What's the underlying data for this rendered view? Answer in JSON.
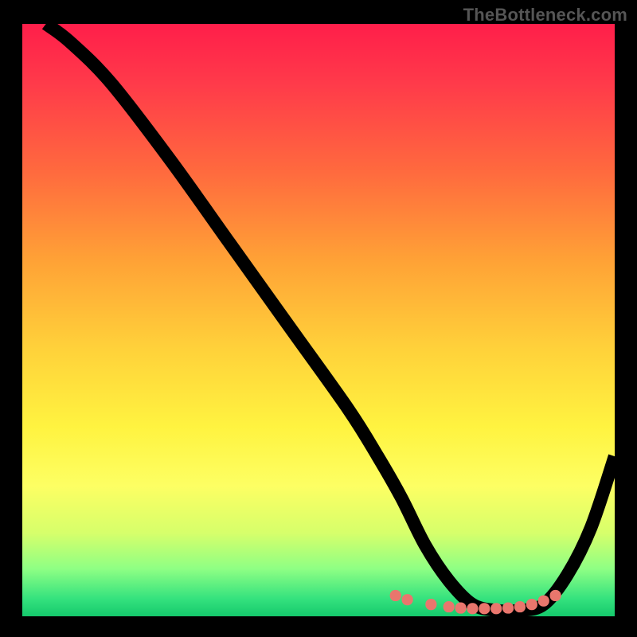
{
  "attribution": "TheBottleneck.com",
  "chart_data": {
    "type": "line",
    "title": "",
    "xlabel": "",
    "ylabel": "",
    "xlim": [
      0,
      100
    ],
    "ylim": [
      0,
      100
    ],
    "series": [
      {
        "name": "bottleneck-curve",
        "x": [
          4,
          8,
          15,
          25,
          35,
          45,
          55,
          60,
          64,
          68,
          72,
          76,
          80,
          84,
          88,
          92,
          96,
          100
        ],
        "y": [
          100,
          97,
          90,
          77,
          63,
          49,
          35,
          27,
          20,
          12,
          6,
          2,
          1,
          1,
          2,
          7,
          15,
          27
        ]
      }
    ],
    "markers": {
      "name": "highlight-dots",
      "x": [
        63,
        65,
        69,
        72,
        74,
        76,
        78,
        80,
        82,
        84,
        86,
        88,
        90
      ],
      "y": [
        3.5,
        2.8,
        2.0,
        1.6,
        1.4,
        1.3,
        1.3,
        1.3,
        1.4,
        1.6,
        2.0,
        2.6,
        3.5
      ]
    },
    "background_gradient": {
      "type": "vertical",
      "stops": [
        {
          "pos": 0,
          "color": "#ff1e4a"
        },
        {
          "pos": 10,
          "color": "#ff3a4a"
        },
        {
          "pos": 25,
          "color": "#ff6a3e"
        },
        {
          "pos": 40,
          "color": "#ffa236"
        },
        {
          "pos": 55,
          "color": "#ffd23a"
        },
        {
          "pos": 68,
          "color": "#fff340"
        },
        {
          "pos": 78,
          "color": "#fdff63"
        },
        {
          "pos": 86,
          "color": "#d6ff6b"
        },
        {
          "pos": 92,
          "color": "#8eff84"
        },
        {
          "pos": 97,
          "color": "#35e27e"
        },
        {
          "pos": 100,
          "color": "#15c96c"
        }
      ]
    }
  }
}
